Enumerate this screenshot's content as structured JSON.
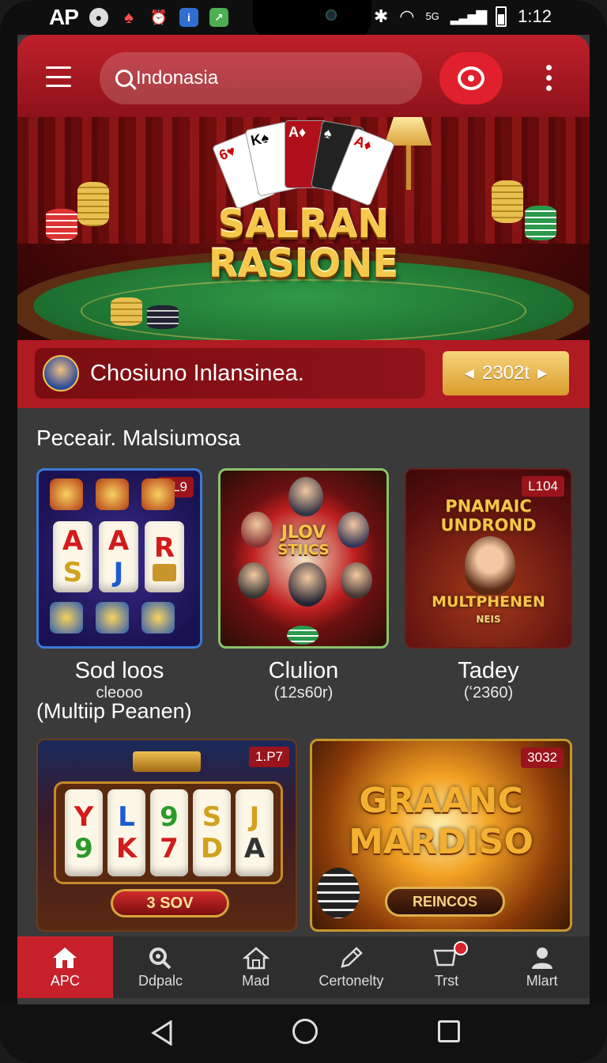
{
  "status_bar": {
    "carrier": "AP",
    "network": "5G",
    "time": "1:12"
  },
  "header": {
    "search_value": "Indonasia"
  },
  "hero": {
    "title_line1": "SALRAN",
    "title_line2": "RASIONE"
  },
  "promo": {
    "text": "Chosiuno Inlansinea.",
    "badge_value": "2302t"
  },
  "section": {
    "title": "Peceair. Malsiumosa"
  },
  "games": [
    {
      "tag": "SL9",
      "name": "Sod loos",
      "sub": "cleooo",
      "extra": "(Multiip Peanen)",
      "reels": [
        "A",
        "A",
        "R",
        "S",
        "J",
        ""
      ]
    },
    {
      "tag": "",
      "name": "Clulion",
      "sub": "(12s60r)",
      "art_title_1": "JLOV",
      "art_title_2": "STIICS"
    },
    {
      "tag": "L104",
      "name": "Tadey",
      "sub": "(ʻ2360)",
      "art_title_1": "PNAMAIC",
      "art_title_2": "UNDROND",
      "art_title_3": "MULTPHENEN",
      "art_title_4": "NEIS"
    },
    {
      "tag": "1.P7",
      "reels": [
        "Y",
        "L",
        "9",
        "S",
        "J",
        "9",
        "K",
        "7",
        "D",
        "A"
      ],
      "button": "3 SOV"
    },
    {
      "tag": "3032",
      "art_title_1": "GRAANC",
      "art_title_2": "MARDISO",
      "button": "REINCOS"
    }
  ],
  "bottom_nav": [
    {
      "label": "APC",
      "icon": "home-icon",
      "active": true
    },
    {
      "label": "Ddpalc",
      "icon": "search-icon",
      "active": false
    },
    {
      "label": "Mad",
      "icon": "house-icon",
      "active": false
    },
    {
      "label": "Certonelty",
      "icon": "edit-icon",
      "active": false
    },
    {
      "label": "Trst",
      "icon": "cart-icon",
      "active": false
    },
    {
      "label": "Mlart",
      "icon": "user-icon",
      "active": false
    }
  ],
  "colors": {
    "brand_red": "#c0202a",
    "gold": "#f6c548",
    "background": "#3a3a3a"
  }
}
